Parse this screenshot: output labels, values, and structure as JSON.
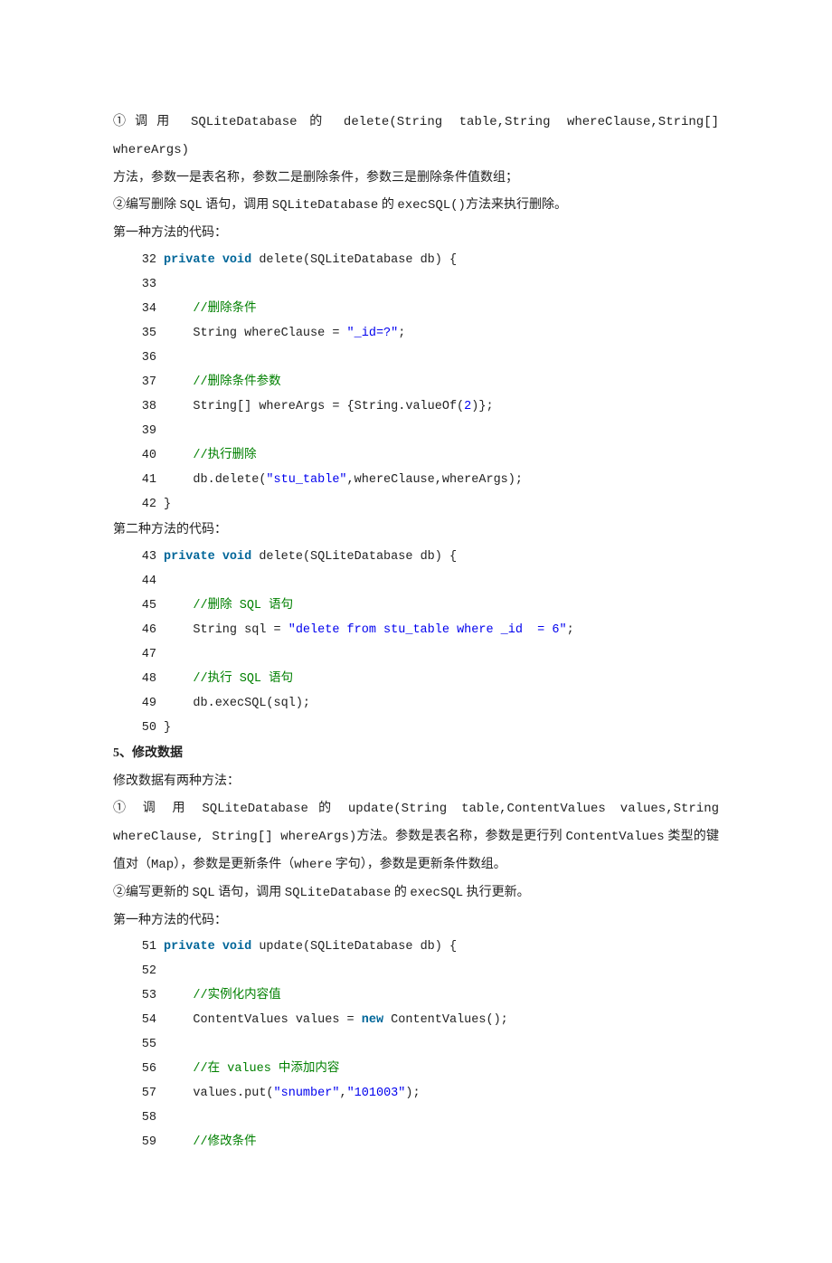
{
  "paragraphs": {
    "p1_a": "①调用 ",
    "p1_b": "SQLiteDatabase",
    "p1_c": " 的 ",
    "p1_d": "delete(String table,String whereClause,String[] whereArgs)",
    "p1_e": "方法，参数一是表名称，参数二是删除条件，参数三是删除条件值数组；",
    "p2_a": "②编写删除 ",
    "p2_sql": "SQL",
    "p2_b": " 语句，调用 ",
    "p2_c": "SQLiteDatabase",
    "p2_d": " 的 ",
    "p2_e": "execSQL()",
    "p2_f": "方法来执行删除。",
    "p3": "第一种方法的代码：",
    "p4": "第二种方法的代码：",
    "h5": "5、修改数据",
    "p5": "修改数据有两种方法：",
    "p6_a": "① 调 用 ",
    "p6_b": "SQLiteDatabase",
    "p6_c": " 的 ",
    "p6_d": "update(String  table,ContentValues  values,String",
    "p6_e": "whereClause, String[] whereArgs)",
    "p6_f": "方法。参数是表名称，参数是更行列 ",
    "p6_g": "ContentValues",
    "p6_h": " 类型的键值对（",
    "p6_i": "Map",
    "p6_j": "），参数是更新条件（",
    "p6_k": "where",
    "p6_l": " 字句），参数是更新条件数组。",
    "p7_a": "②编写更新的 ",
    "p7_sql": "SQL",
    "p7_b": " 语句，调用 ",
    "p7_c": "SQLiteDatabase",
    "p7_d": " 的 ",
    "p7_e": "execSQL",
    "p7_f": " 执行更新。",
    "p8": "第一种方法的代码："
  },
  "code1": {
    "l32_kw1": "private",
    "l32_kw2": "void",
    "l32_rest": " delete(SQLiteDatabase db) {  ",
    "l34_cm": "//删除条件  ",
    "l35": "String whereClause = ",
    "l35_str": "\"_id=?\"",
    "l35_end": ";  ",
    "l37_cm": "//删除条件参数  ",
    "l38_a": "String[] whereArgs = {String.valueOf(",
    "l38_n": "2",
    "l38_b": ")};  ",
    "l40_cm": "//执行删除  ",
    "l41_a": "db.delete(",
    "l41_s": "\"stu_table\"",
    "l41_b": ",whereClause,whereArgs);  ",
    "l42": "}  "
  },
  "code2": {
    "l43_kw1": "private",
    "l43_kw2": "void",
    "l43_rest": " delete(SQLiteDatabase db) {  ",
    "l45_cm_a": "//删除 ",
    "l45_cm_sql": "SQL",
    "l45_cm_b": " 语句  ",
    "l46_a": "String sql = ",
    "l46_s": "\"delete from stu_table where _id  = 6\"",
    "l46_b": ";  ",
    "l48_cm_a": "//执行 ",
    "l48_cm_sql": "SQL",
    "l48_cm_b": " 语句  ",
    "l49": "db.execSQL(sql);  ",
    "l50": "}  "
  },
  "code3": {
    "l51_kw1": "private",
    "l51_kw2": "void",
    "l51_rest": " update(SQLiteDatabase db) {  ",
    "l53_cm": "//实例化内容值",
    "l54_a": "    ContentValues values = ",
    "l54_kw": "new",
    "l54_b": " ContentValues();  ",
    "l56_cm_a": "//在 ",
    "l56_cm_v": "values",
    "l56_cm_b": " 中添加内容  ",
    "l57_a": "    values.put(",
    "l57_s1": "\"snumber\"",
    "l57_c": ",",
    "l57_s2": "\"101003\"",
    "l57_b": ");  ",
    "l59_cm": "//修改条件  "
  },
  "ln": {
    "32": "32",
    "33": "33",
    "34": "34",
    "35": "35",
    "36": "36",
    "37": "37",
    "38": "38",
    "39": "39",
    "40": "40",
    "41": "41",
    "42": "42",
    "43": "43",
    "44": "44",
    "45": "45",
    "46": "46",
    "47": "47",
    "48": "48",
    "49": "49",
    "50": "50",
    "51": "51",
    "52": "52",
    "53": "53",
    "54": "54",
    "55": "55",
    "56": "56",
    "57": "57",
    "58": "58",
    "59": "59"
  }
}
